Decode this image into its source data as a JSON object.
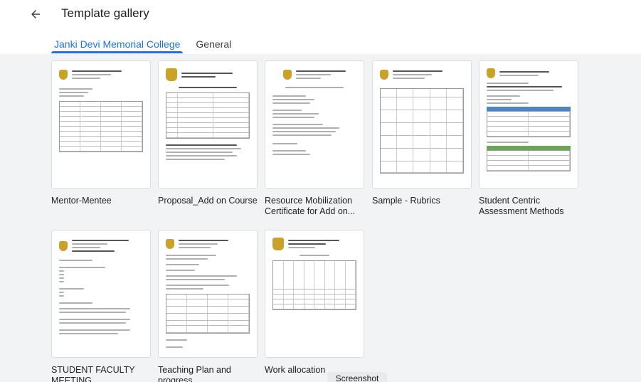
{
  "header": {
    "title": "Template gallery"
  },
  "tabs": [
    {
      "label": "Janki Devi Memorial College",
      "active": true
    },
    {
      "label": "General",
      "active": false
    }
  ],
  "templates": [
    {
      "name": "Mentor-Mentee"
    },
    {
      "name": "Proposal_Add on Course"
    },
    {
      "name": "Resource Mobilization Certificate for Add on..."
    },
    {
      "name": "Sample - Rubrics"
    },
    {
      "name": "Student Centric Assessment Methods"
    },
    {
      "name": "STUDENT FACULTY MEETING"
    },
    {
      "name": "Teaching Plan and progress"
    },
    {
      "name": "Work allocation"
    }
  ],
  "tooltip": {
    "text": "Screenshot"
  },
  "colors": {
    "accent": "#1a73e8",
    "background": "#f1f3f4",
    "seal": "#c9a227"
  }
}
